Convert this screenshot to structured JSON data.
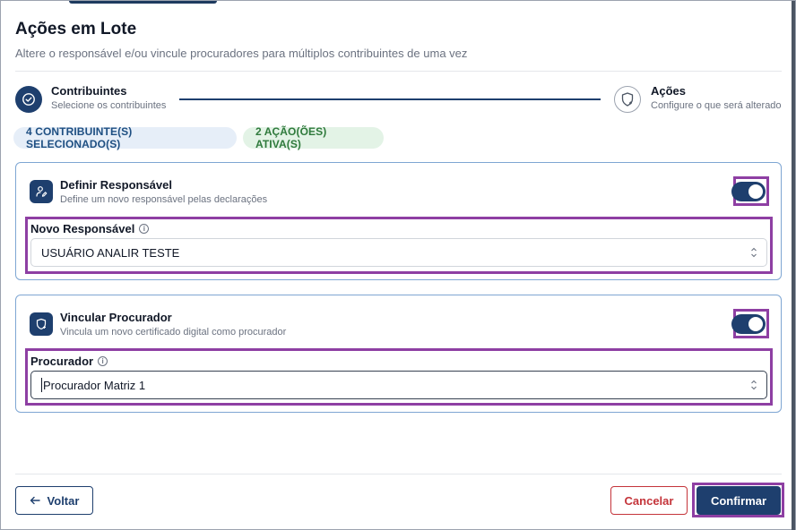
{
  "dialog": {
    "title": "Ações em Lote",
    "subtitle": "Altere o responsável e/ou vincule procuradores para múltiplos contribuintes de uma vez"
  },
  "stepper": {
    "steps": [
      {
        "title": "Contribuintes",
        "description": "Selecione os contribuintes",
        "state": "completed",
        "icon": "check-circle-icon"
      },
      {
        "title": "Ações",
        "description": "Configure o que será alterado",
        "state": "pending",
        "icon": "shield-plus-icon"
      }
    ]
  },
  "chips": {
    "selected": "4 CONTRIBUINTE(S) SELECIONADO(S)",
    "active": "2 AÇÃO(ÕES) ATIVA(S)"
  },
  "cards": [
    {
      "title": "Definir Responsável",
      "description": "Define um novo responsável pelas declarações",
      "icon": "user-edit-icon",
      "enabled": true,
      "field_label": "Novo Responsável",
      "field_value": "USUÁRIO ANALIR TESTE"
    },
    {
      "title": "Vincular Procurador",
      "description": "Vincula um novo certificado digital como procurador",
      "icon": "shield-plus-icon",
      "enabled": true,
      "field_label": "Procurador",
      "field_value": "Procurador Matriz 1"
    }
  ],
  "footer": {
    "back_label": "Voltar",
    "cancel_label": "Cancelar",
    "confirm_label": "Confirmar"
  },
  "colors": {
    "primary": "#1e3f6e",
    "danger": "#c4343a",
    "highlight": "#8e3fa3",
    "chip_blue_bg": "#e6eef8",
    "chip_green_bg": "#e3f3e6"
  }
}
